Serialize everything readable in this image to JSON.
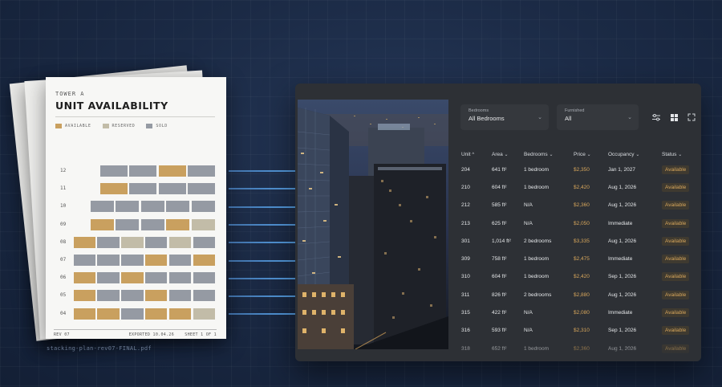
{
  "document": {
    "subtitle": "TOWER A",
    "title": "UNIT AVAILABILITY",
    "legend": [
      {
        "label": "AVAILABLE",
        "color": "#c9a05f"
      },
      {
        "label": "RESERVED",
        "color": "#c2bca8"
      },
      {
        "label": "SOLD",
        "color": "#959aa3"
      }
    ],
    "floors": [
      {
        "label": "12",
        "units": [
          "sold",
          "sold",
          "available",
          "sold"
        ]
      },
      {
        "label": "11",
        "units": [
          "available",
          "sold",
          "sold",
          "sold"
        ]
      },
      {
        "label": "10",
        "units": [
          "sold",
          "sold",
          "sold",
          "sold",
          "sold"
        ]
      },
      {
        "label": "09",
        "units": [
          "available",
          "sold",
          "sold",
          "available",
          "reserved"
        ]
      },
      {
        "label": "08",
        "units": [
          "available",
          "sold",
          "reserved",
          "sold",
          "reserved",
          "sold"
        ]
      },
      {
        "label": "07",
        "units": [
          "sold",
          "sold",
          "sold",
          "available",
          "sold",
          "available"
        ]
      },
      {
        "label": "06",
        "units": [
          "available",
          "sold",
          "available",
          "sold",
          "sold",
          "sold"
        ]
      },
      {
        "label": "05",
        "units": [
          "available",
          "sold",
          "sold",
          "available",
          "sold",
          "sold"
        ]
      },
      {
        "label": "04",
        "units": [
          "available",
          "available",
          "sold",
          "available",
          "available",
          "reserved"
        ]
      }
    ],
    "footer_left": "REV 07",
    "footer_mid": "EXPORTED 10.04.26",
    "footer_right": "SHEET 1 OF 1"
  },
  "filename": "stacking-plan-rev07-FINAL.pdf",
  "app": {
    "filters": {
      "bedrooms": {
        "label": "Bedrooms",
        "value": "All Bedrooms"
      },
      "furnished": {
        "label": "Furnished",
        "value": "All"
      }
    },
    "icons": [
      "sliders-icon",
      "grid-view-icon",
      "fullscreen-icon"
    ],
    "columns": [
      "Unit",
      "Area",
      "Bedrooms",
      "Price",
      "Occupancy",
      "Status"
    ],
    "rows": [
      [
        "204",
        "641 ft²",
        "1 bedroom",
        "$2,350",
        "Jan 1, 2027",
        "Available"
      ],
      [
        "210",
        "604 ft²",
        "1 bedroom",
        "$2,420",
        "Aug 1, 2026",
        "Available"
      ],
      [
        "212",
        "585 ft²",
        "N/A",
        "$2,360",
        "Aug 1, 2026",
        "Available"
      ],
      [
        "213",
        "625 ft²",
        "N/A",
        "$2,050",
        "Immediate",
        "Available"
      ],
      [
        "301",
        "1,014 ft²",
        "2 bedrooms",
        "$3,335",
        "Aug 1, 2026",
        "Available"
      ],
      [
        "309",
        "758 ft²",
        "1 bedroom",
        "$2,475",
        "Immediate",
        "Available"
      ],
      [
        "310",
        "604 ft²",
        "1 bedroom",
        "$2,420",
        "Sep 1, 2026",
        "Available"
      ],
      [
        "311",
        "826 ft²",
        "2 bedrooms",
        "$2,880",
        "Aug 1, 2026",
        "Available"
      ],
      [
        "315",
        "422 ft²",
        "N/A",
        "$2,080",
        "Immediate",
        "Available"
      ],
      [
        "316",
        "593 ft²",
        "N/A",
        "$2,310",
        "Sep 1, 2026",
        "Available"
      ],
      [
        "318",
        "652 ft²",
        "1 bedroom",
        "$2,360",
        "Aug 1, 2026",
        "Available"
      ]
    ]
  }
}
